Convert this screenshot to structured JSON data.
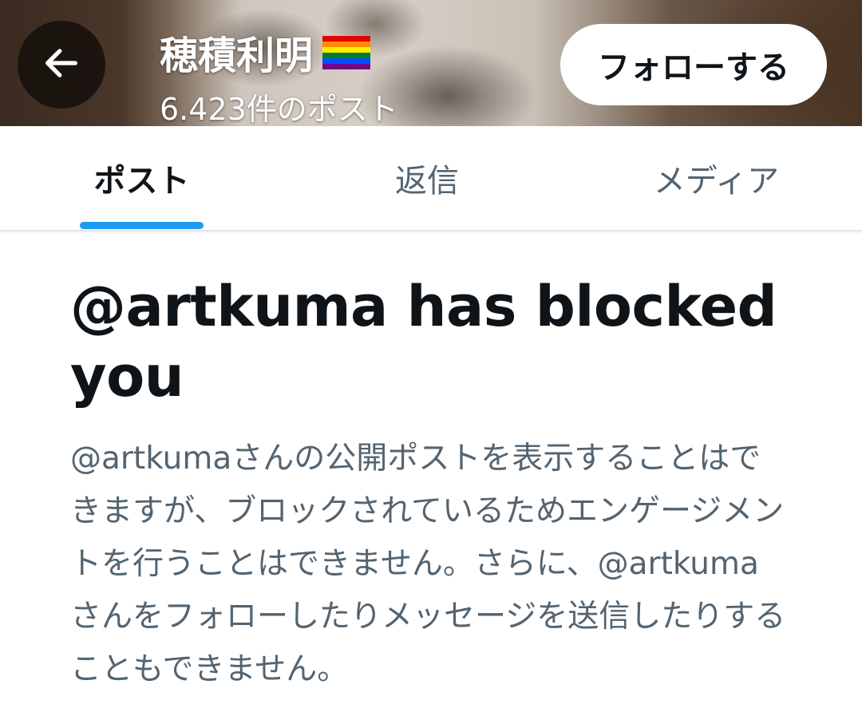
{
  "header": {
    "back_icon": "arrow-left-icon",
    "name": "穂積利明",
    "flag_icon": "rainbow-flag-icon",
    "post_count": "6.423件のポスト",
    "follow_label": "フォローする"
  },
  "tabs": [
    {
      "label": "ポスト",
      "active": true
    },
    {
      "label": "返信",
      "active": false
    },
    {
      "label": "メディア",
      "active": false
    }
  ],
  "blocked": {
    "title": "@artkuma has blocked you",
    "description": "@artkumaさんの公開ポストを表示することはできますが、ブロックされているためエンゲージメントを行うことはできません。さらに、@artkumaさんをフォローしたりメッセージを送信したりすることもできません。"
  },
  "colors": {
    "accent": "#1d9bf0",
    "text_primary": "#0f1419",
    "text_secondary": "#536471"
  }
}
